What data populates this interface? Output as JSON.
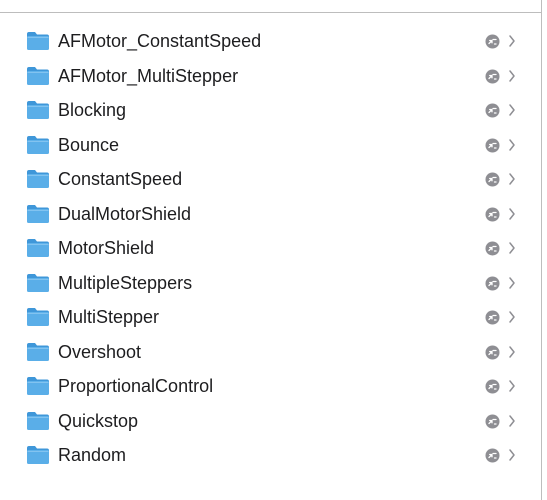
{
  "folders": [
    {
      "name": "AFMotor_ConstantSpeed",
      "icon": "folder-icon",
      "status_icon": "cloud-status-icon",
      "disclosure_icon": "chevron-right-icon"
    },
    {
      "name": "AFMotor_MultiStepper",
      "icon": "folder-icon",
      "status_icon": "cloud-status-icon",
      "disclosure_icon": "chevron-right-icon"
    },
    {
      "name": "Blocking",
      "icon": "folder-icon",
      "status_icon": "cloud-status-icon",
      "disclosure_icon": "chevron-right-icon"
    },
    {
      "name": "Bounce",
      "icon": "folder-icon",
      "status_icon": "cloud-status-icon",
      "disclosure_icon": "chevron-right-icon"
    },
    {
      "name": "ConstantSpeed",
      "icon": "folder-icon",
      "status_icon": "cloud-status-icon",
      "disclosure_icon": "chevron-right-icon"
    },
    {
      "name": "DualMotorShield",
      "icon": "folder-icon",
      "status_icon": "cloud-status-icon",
      "disclosure_icon": "chevron-right-icon"
    },
    {
      "name": "MotorShield",
      "icon": "folder-icon",
      "status_icon": "cloud-status-icon",
      "disclosure_icon": "chevron-right-icon"
    },
    {
      "name": "MultipleSteppers",
      "icon": "folder-icon",
      "status_icon": "cloud-status-icon",
      "disclosure_icon": "chevron-right-icon"
    },
    {
      "name": "MultiStepper",
      "icon": "folder-icon",
      "status_icon": "cloud-status-icon",
      "disclosure_icon": "chevron-right-icon"
    },
    {
      "name": "Overshoot",
      "icon": "folder-icon",
      "status_icon": "cloud-status-icon",
      "disclosure_icon": "chevron-right-icon"
    },
    {
      "name": "ProportionalControl",
      "icon": "folder-icon",
      "status_icon": "cloud-status-icon",
      "disclosure_icon": "chevron-right-icon"
    },
    {
      "name": "Quickstop",
      "icon": "folder-icon",
      "status_icon": "cloud-status-icon",
      "disclosure_icon": "chevron-right-icon"
    },
    {
      "name": "Random",
      "icon": "folder-icon",
      "status_icon": "cloud-status-icon",
      "disclosure_icon": "chevron-right-icon"
    }
  ],
  "colors": {
    "folder_body": "#5aaee8",
    "folder_tab": "#3f97d9",
    "text": "#1d1d1f",
    "status_icon": "#8e8e93",
    "chevron": "#8e8e93",
    "divider": "#bdbdbd"
  }
}
